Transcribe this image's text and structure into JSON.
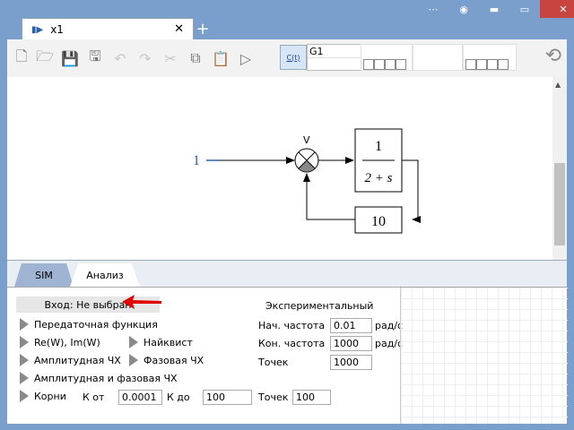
{
  "window": {
    "controls": [
      "⋯",
      "◉",
      "▬",
      "▭",
      "✕"
    ]
  },
  "tab": {
    "label": "x1",
    "close": "✕",
    "add": "+"
  },
  "toolbar": {
    "ct_button": "C(t)",
    "model_name": "G1"
  },
  "diagram": {
    "input_label": "1",
    "block_numerator": "1",
    "block_denominator": "2 + s",
    "feedback_block": "10",
    "summator_sign": "V"
  },
  "bottom_tabs": {
    "sim": "SIM",
    "analysis": "Анализ"
  },
  "analysis": {
    "input_status": "Вход: Не выбран",
    "experimental_title": "Экспериментальный",
    "options": {
      "transfer_function": "Передаточная функция",
      "re_im": "Re(W), Im(W)",
      "nyquist": "Найквист",
      "amplitude": "Амплитудная ЧХ",
      "phase": "Фазовая ЧХ",
      "amp_phase": "Амплитудная и фазовая ЧХ",
      "roots": "Корни"
    },
    "roots": {
      "k_from_label": "К от",
      "k_from": "0.0001",
      "k_to_label": "К до",
      "k_to": "100",
      "points_label": "Точек",
      "points": "100"
    },
    "experimental": {
      "start_freq_label": "Нач. частота",
      "start_freq": "0.01",
      "start_unit": "рад/с",
      "end_freq_label": "Кон. частота",
      "end_freq": "1000",
      "end_unit": "рад/с",
      "points_label": "Точек",
      "points": "1000"
    }
  },
  "colors": {
    "frame": "#7b9fcd",
    "close": "#c8453f",
    "arrow_red": "#e00000",
    "input_blue": "#2b5fa8"
  }
}
